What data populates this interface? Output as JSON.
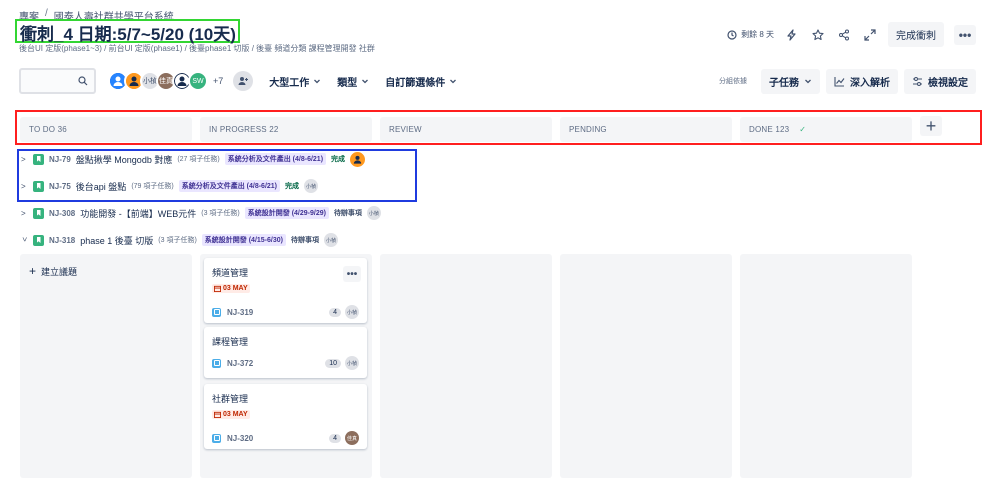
{
  "breadcrumb": {
    "project": "專案",
    "separator": "/",
    "space": "國泰人壽社群共學平台系統"
  },
  "sprint": {
    "title": "衝刺_4 日期:5/7~5/20 (10天)",
    "subtitle": "後台UI 定版(phase1~3) / 前台UI 定版(phase1) / 後臺phase1 切版 / 後臺 頻道分類 課程管理開發 社群"
  },
  "header_right": {
    "remaining": "剩餘 8 天",
    "complete_button": "完成衝刺",
    "more": "•••"
  },
  "toolbar": {
    "search_placeholder": "",
    "avatars": [
      "",
      "",
      "小楨",
      "佳真",
      "",
      "SW"
    ],
    "more_avatars": "+7",
    "filters": [
      "大型工作",
      "類型",
      "自訂篩選條件"
    ],
    "group_by_label": "分組依據",
    "group_by_value": "子任務",
    "insights": "深入解析",
    "view_settings": "檢視設定"
  },
  "columns": [
    {
      "name": "TO DO 36"
    },
    {
      "name": "IN PROGRESS 22"
    },
    {
      "name": "REVIEW"
    },
    {
      "name": "PENDING"
    },
    {
      "name": "DONE 123",
      "check": "✓"
    }
  ],
  "swimlanes": [
    {
      "key": "NJ-79",
      "title": "盤點揪學 Mongodb 對應",
      "count": "(27 項子任務)",
      "epic": "系統分析及文件產出 (4/8-6/21)",
      "status": "完成",
      "assignee": ""
    },
    {
      "key": "NJ-75",
      "title": "後台api 盤點",
      "count": "(79 項子任務)",
      "epic": "系統分析及文件產出 (4/8-6/21)",
      "status": "完成",
      "assignee": "小楨"
    },
    {
      "key": "NJ-308",
      "title": "功能開發 -【前端】WEB元件",
      "count": "(3 項子任務)",
      "epic": "系統設計開發 (4/29-9/29)",
      "status": "待辦事項",
      "assignee": "小楨"
    },
    {
      "key": "NJ-318",
      "title": "phase 1 後臺 切版",
      "count": "(3 項子任務)",
      "epic": "系統設計開發 (4/15-6/30)",
      "status": "待辦事項",
      "assignee": "小楨"
    }
  ],
  "board": {
    "create_issue": "建立議題",
    "cards": [
      {
        "title": "頻道管理",
        "due": "03 MAY",
        "key": "NJ-319",
        "points": "4",
        "assignee": "小楨"
      },
      {
        "title": "課程管理",
        "due": "",
        "key": "NJ-372",
        "points": "10",
        "assignee": "小楨"
      },
      {
        "title": "社群管理",
        "due": "03 MAY",
        "key": "NJ-320",
        "points": "4",
        "assignee": "佳真"
      }
    ]
  },
  "colors": {
    "title_highlight": "#33d633",
    "columns_highlight": "#ff1f1f",
    "swimlanes_highlight": "#1f3bdf"
  }
}
